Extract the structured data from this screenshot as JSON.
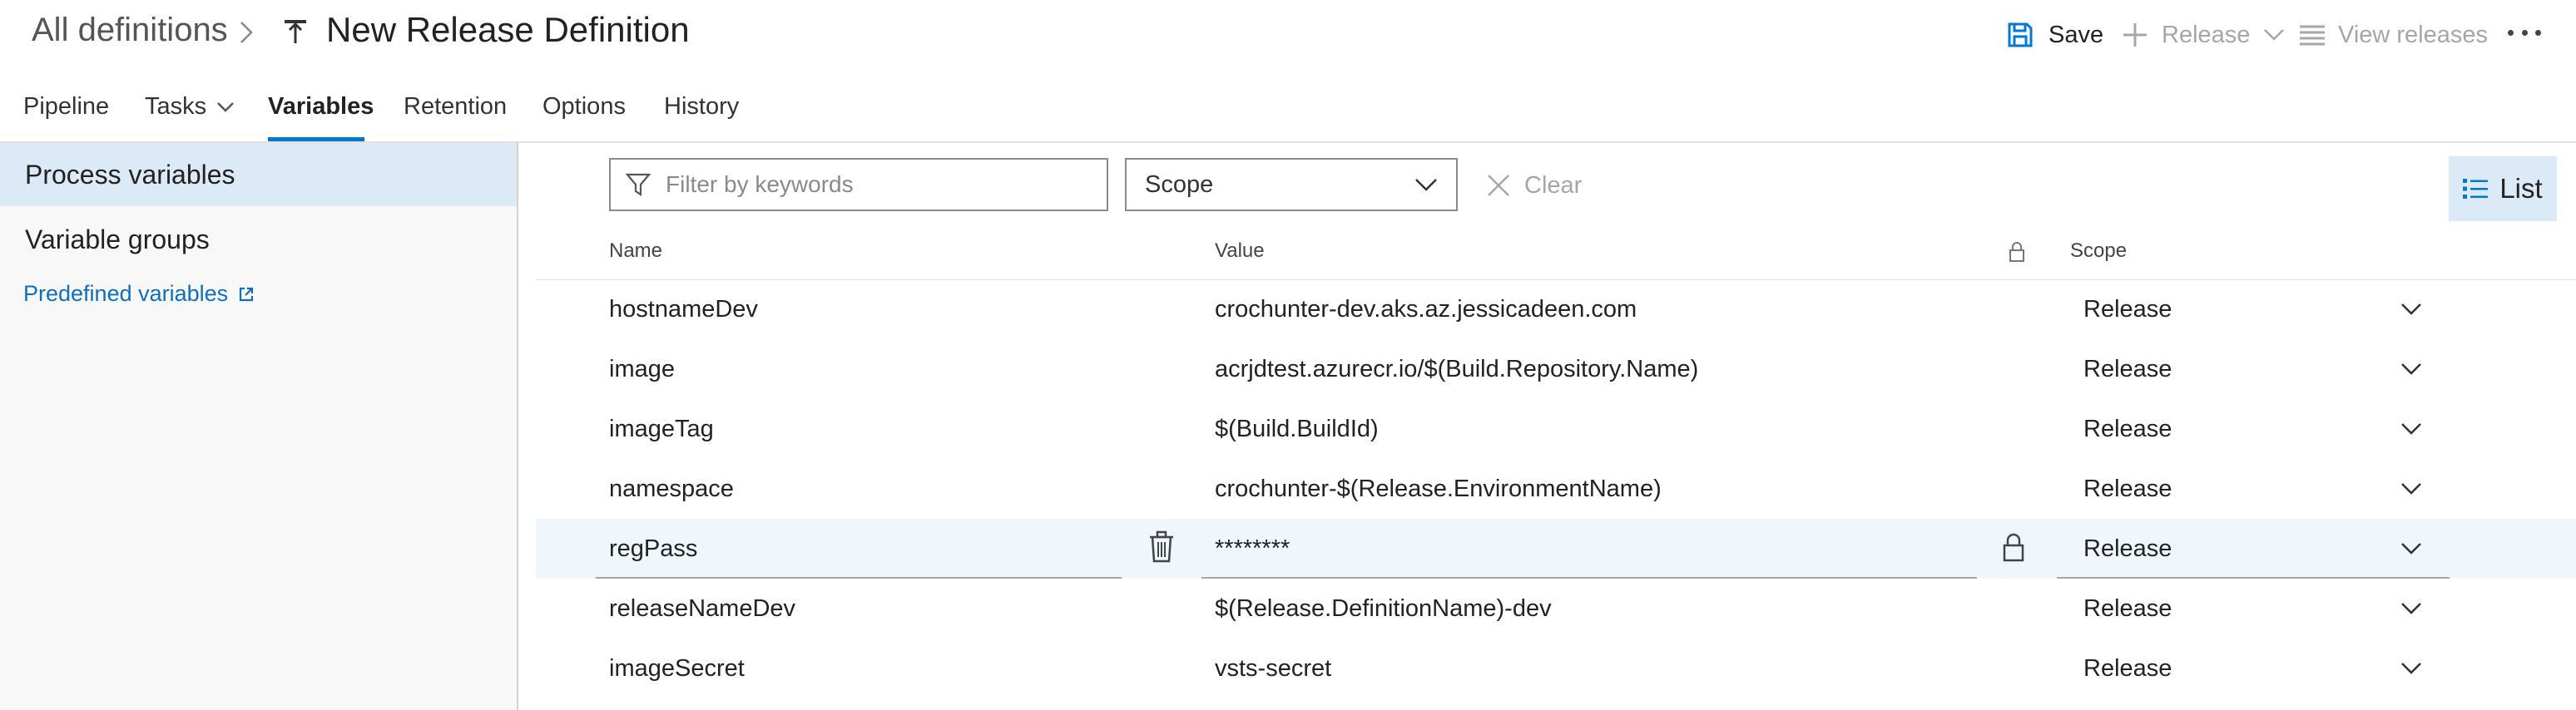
{
  "header": {
    "breadcrumb": "All definitions",
    "title": "New Release Definition",
    "save_label": "Save",
    "release_label": "Release",
    "view_releases_label": "View releases",
    "icons": {
      "breadcrumb_separator": "chevron-right-icon",
      "definition": "release-definition-icon",
      "save": "save-icon",
      "release": "plus-icon",
      "view_releases": "list-icon",
      "more": "more-icon"
    }
  },
  "tabs": {
    "pipeline": "Pipeline",
    "tasks": "Tasks",
    "variables": "Variables",
    "retention": "Retention",
    "options": "Options",
    "history": "History",
    "active": "Variables"
  },
  "sidebar": {
    "process_variables": "Process variables",
    "variable_groups": "Variable groups",
    "predefined_variables": "Predefined variables",
    "selected": "Process variables"
  },
  "toolbar": {
    "filter_placeholder": "Filter by keywords",
    "scope_label": "Scope",
    "clear_label": "Clear",
    "list_label": "List"
  },
  "table": {
    "columns": {
      "name": "Name",
      "value": "Value",
      "scope": "Scope"
    },
    "rows": [
      {
        "name": "hostnameDev",
        "value": "crochunter-dev.aks.az.jessicadeen.com",
        "scope": "Release"
      },
      {
        "name": "image",
        "value": "acrjdtest.azurecr.io/$(Build.Repository.Name)",
        "scope": "Release"
      },
      {
        "name": "imageTag",
        "value": "$(Build.BuildId)",
        "scope": "Release"
      },
      {
        "name": "namespace",
        "value": "crochunter-$(Release.EnvironmentName)",
        "scope": "Release"
      },
      {
        "name": "regPass",
        "value": "********",
        "scope": "Release",
        "secret": true,
        "selected": true
      },
      {
        "name": "releaseNameDev",
        "value": "$(Release.DefinitionName)-dev",
        "scope": "Release"
      },
      {
        "name": "imageSecret",
        "value": "vsts-secret",
        "scope": "Release"
      }
    ]
  },
  "colors": {
    "accent": "#0078d4",
    "link": "#106ebe",
    "selected_bg": "#dce9f7",
    "row_selected_bg": "#eff6fc",
    "disabled_text": "#a6a6a6"
  }
}
